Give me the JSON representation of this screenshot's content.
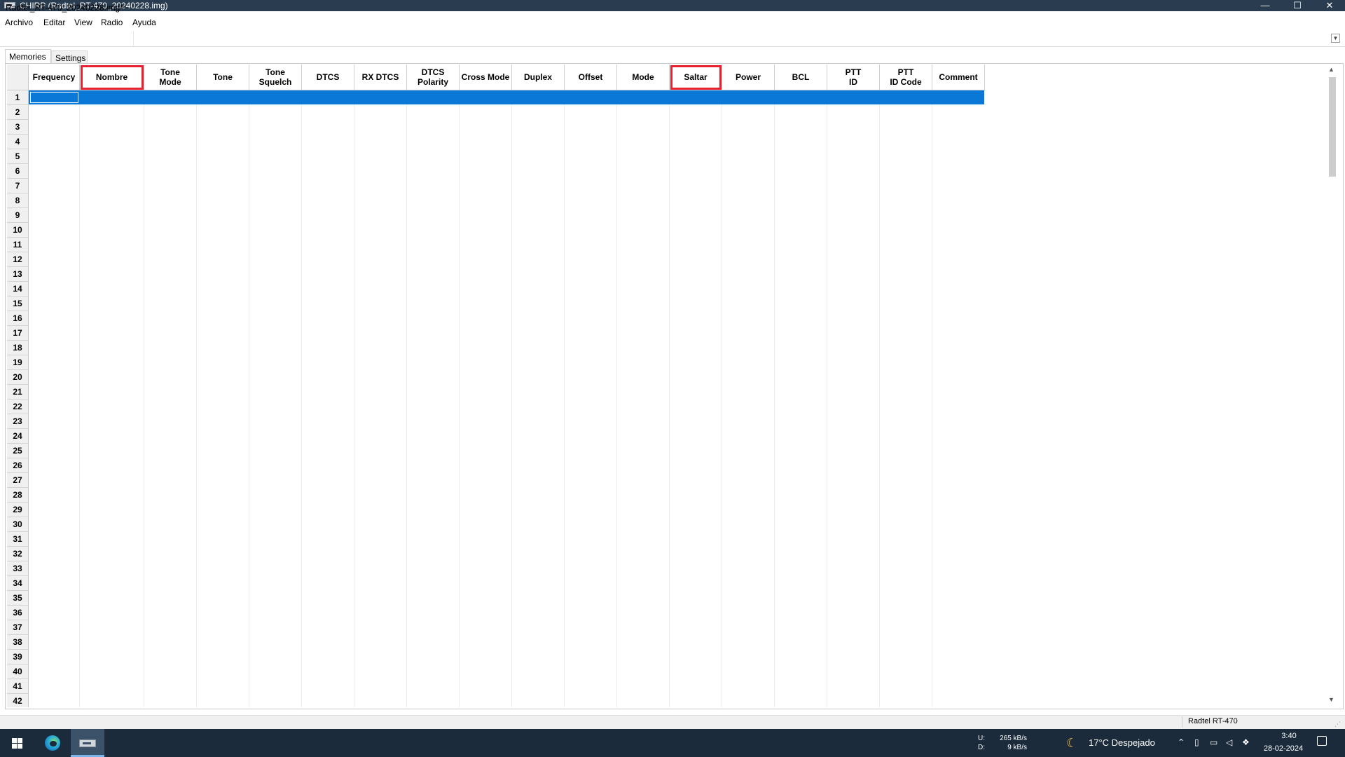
{
  "window": {
    "title": "CHIRP (Radtel_RT-470_20240228.img)",
    "minimize": "—",
    "maximize": "☐",
    "close": "✕"
  },
  "menu": [
    "Archivo",
    "Editar",
    "View",
    "Radio",
    "Ayuda"
  ],
  "doc_tab": {
    "label": "Radtel_RT-470_20240228.img*",
    "close": "×"
  },
  "subtabs": {
    "memories": "Memories",
    "settings": "Settings"
  },
  "columns": [
    {
      "label": "Frequency",
      "highlighted": false
    },
    {
      "label": "Nombre",
      "highlighted": true
    },
    {
      "label": "Tone\nMode",
      "highlighted": false
    },
    {
      "label": "Tone",
      "highlighted": false
    },
    {
      "label": "Tone\nSquelch",
      "highlighted": false
    },
    {
      "label": "DTCS",
      "highlighted": false
    },
    {
      "label": "RX DTCS",
      "highlighted": false
    },
    {
      "label": "DTCS\nPolarity",
      "highlighted": false
    },
    {
      "label": "Cross Mode",
      "highlighted": false
    },
    {
      "label": "Duplex",
      "highlighted": false
    },
    {
      "label": "Offset",
      "highlighted": false
    },
    {
      "label": "Mode",
      "highlighted": false
    },
    {
      "label": "Saltar",
      "highlighted": true
    },
    {
      "label": "Power",
      "highlighted": false
    },
    {
      "label": "BCL",
      "highlighted": false
    },
    {
      "label": "PTT\nID",
      "highlighted": false
    },
    {
      "label": "PTT\nID Code",
      "highlighted": false
    },
    {
      "label": "Comment",
      "highlighted": false
    }
  ],
  "rows": [
    "1",
    "2",
    "3",
    "4",
    "5",
    "6",
    "7",
    "8",
    "9",
    "10",
    "11",
    "12",
    "13",
    "14",
    "15",
    "16",
    "17",
    "18",
    "19",
    "20",
    "21",
    "22",
    "23",
    "24",
    "25",
    "26",
    "27",
    "28",
    "29",
    "30",
    "31",
    "32",
    "33",
    "34",
    "35",
    "36",
    "37",
    "38",
    "39",
    "40",
    "41",
    "42"
  ],
  "selected_row": 1,
  "status_bar": {
    "radio_model": "Radtel RT-470"
  },
  "taskbar": {
    "network_upload_label": "U:",
    "network_upload": "265 kB/s",
    "network_download_label": "D:",
    "network_download": "9 kB/s",
    "weather": "17°C  Despejado",
    "time": "3:40",
    "date": "28-02-2024"
  },
  "colors": {
    "titlebar": "#2a3c4f",
    "selection": "#0a78d7",
    "highlight_border": "#e8202f",
    "taskbar": "#1b2b3c"
  }
}
